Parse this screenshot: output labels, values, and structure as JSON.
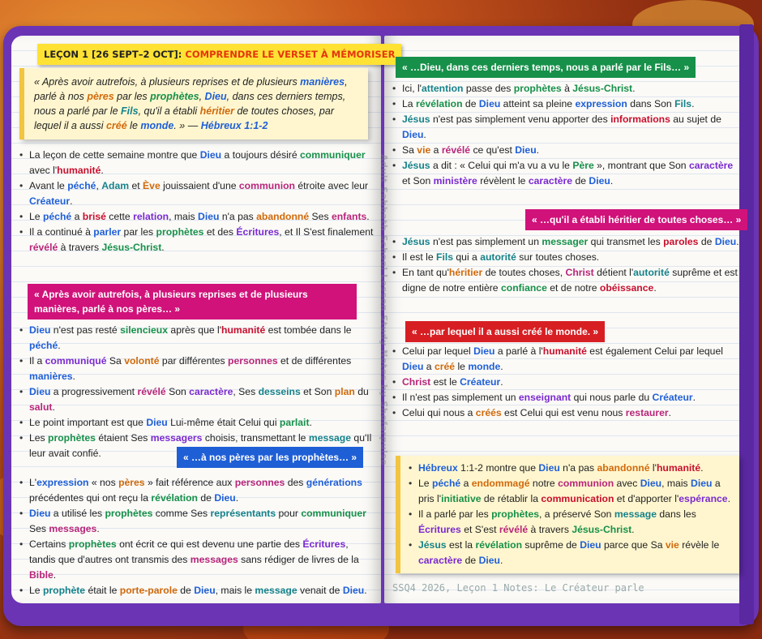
{
  "title": {
    "part1": "LEÇON 1 [26 SEPT–2 OCT]:",
    "part2": "COMPRENDRE LE VERSET À MÉMORISER"
  },
  "quote": {
    "text": "« Après avoir autrefois, à plusieurs reprises et de plusieurs manières, parlé à nos pères par les prophètes, Dieu, dans ces derniers temps, nous a parlé par le Fils, qu'il a établi héritier de toutes choses, par lequel il a aussi créé le monde. » —",
    "ref": "Hébreux 1:1-2"
  },
  "spine": "Adult Sabbath School Lesson Study Notes by Shofarpulse",
  "left_list_1": [
    "La leçon de cette semaine montre que Dieu a toujours désiré communiquer avec l'humanité.",
    "Avant le péché, Adam et Ève jouissaient d'une communion étroite avec leur Créateur.",
    "Le péché a brisé cette relation, mais Dieu n'a pas abandonné Ses enfants.",
    "Il a continué à parler par les prophètes et des Écritures, et Il S'est finalement révélé à travers Jésus-Christ."
  ],
  "banner_l1": "« Après avoir autrefois, à plusieurs reprises et de plusieurs manières, parlé à nos pères… »",
  "left_list_2": [
    "Dieu n'est pas resté silencieux après que l'humanité est tombée dans le péché.",
    "Il a communiqué Sa volonté par différentes personnes et de différentes manières.",
    "Dieu a progressivement révélé Son caractère, Ses desseins et Son plan du salut.",
    "Le point important est que Dieu Lui-même était Celui qui parlait.",
    "Les prophètes étaient Ses messagers choisis, transmettant le message qu'Il leur avait confié."
  ],
  "banner_l2": "« …à nos pères par les prophètes… »",
  "left_list_3": [
    "L'expression « nos pères » fait référence aux personnes des générations précédentes qui ont reçu la révélation de Dieu.",
    "Dieu a utilisé les prophètes comme Ses représentants pour communiquer Ses messages.",
    "Certains prophètes ont écrit ce qui est devenu une partie des Écritures, tandis que d'autres ont transmis des messages sans rédiger de livres de la Bible.",
    "Le prophète était le porte-parole de Dieu, mais le message venait de Dieu."
  ],
  "banner_r1": "« …Dieu, dans ces derniers temps, nous a parlé par le Fils… »",
  "right_list_1": [
    "Ici, l'attention passe des prophètes à Jésus-Christ.",
    "La révélation de Dieu atteint sa pleine expression dans Son Fils.",
    "Jésus n'est pas simplement venu apporter des informations au sujet de Dieu.",
    "Sa vie a révélé ce qu'est Dieu.",
    "Jésus a dit : « Celui qui m'a vu a vu le Père », montrant que Son caractère et Son ministère révèlent le caractère de Dieu."
  ],
  "banner_r2": "« …qu'il a établi héritier de toutes choses… »",
  "right_list_2": [
    "Jésus n'est pas simplement un messager qui transmet les paroles de Dieu.",
    "Il est le Fils qui a autorité sur toutes choses.",
    "En tant qu'héritier de toutes choses, Christ détient l'autorité suprême et est digne de notre entière confiance et de notre obéissance."
  ],
  "banner_r3": "« …par lequel il a aussi créé le monde. »",
  "right_list_3": [
    "Celui par lequel Dieu a parlé à l'humanité est également Celui par lequel Dieu a créé le monde.",
    "Christ est le Créateur.",
    "Il n'est pas simplement un enseignant qui nous parle du Créateur.",
    "Celui qui nous a créés est Celui qui est venu nous restaurer."
  ],
  "summary": [
    "Hébreux 1:1-2 montre que Dieu n'a pas abandonné l'humanité.",
    "Le péché a endommagé notre communion avec Dieu, mais Dieu a pris l'initiative de rétablir la communication et d'apporter l'espérance.",
    "Il a parlé par les prophètes, a préservé Son message dans les Écritures et S'est révélé à travers Jésus-Christ.",
    "Jésus est la révélation suprême de Dieu parce que Sa vie révèle le caractère de Dieu."
  ],
  "footer": "SSQ4 2026, Leçon 1 Notes: Le Créateur parle",
  "highlights": {
    "Dieu": "blue",
    "communiquer": "green",
    "humanité": "red",
    "péché": "blue",
    "Adam": "teal",
    "Ève": "orange",
    "communion": "magenta",
    "Créateur": "blue",
    "brisé": "red",
    "relation": "purple",
    "abandonné": "orange",
    "enfants": "magenta",
    "parler": "blue",
    "prophètes": "green",
    "Écritures": "purple",
    "révélé": "magenta",
    "Jésus-Christ": "green",
    "silencieux": "green",
    "communiqué": "purple",
    "volonté": "orange",
    "personnes": "magenta",
    "manières": "blue",
    "progressivement": "none",
    "caractère": "purple",
    "desseins": "teal",
    "plan": "orange",
    "salut": "magenta",
    "parlait": "green",
    "messagers": "purple",
    "message": "teal",
    "pères": "orange",
    "générations": "blue",
    "révélation": "green",
    "représentants": "teal",
    "Bible": "magenta",
    "prophète": "teal",
    "porte-parole": "orange",
    "attention": "teal",
    "expression": "blue",
    "Fils": "teal",
    "informations": "red",
    "vie": "orange",
    "Jésus": "teal",
    "Père": "green",
    "ministère": "purple",
    "messager": "green",
    "paroles": "red",
    "autorité": "teal",
    "héritier": "orange",
    "Christ": "magenta",
    "confiance": "green",
    "obéissance": "red",
    "créé": "orange",
    "monde": "blue",
    "enseignant": "purple",
    "créés": "orange",
    "restaurer": "magenta",
    "Hébreux": "blue",
    "endommagé": "orange",
    "initiative": "green",
    "communication": "red",
    "espérance": "purple",
    "messages": "magenta"
  }
}
